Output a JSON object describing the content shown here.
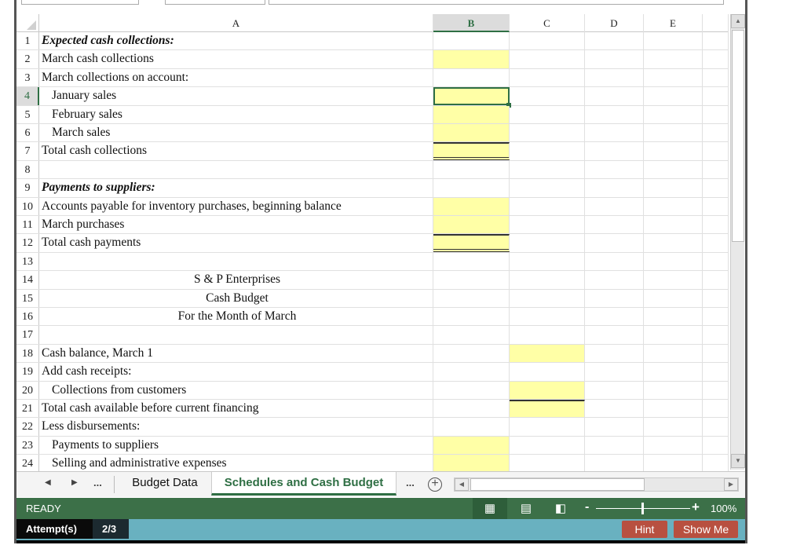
{
  "columns": [
    "A",
    "B",
    "C",
    "D",
    "E"
  ],
  "selected_column": "B",
  "selected_row": 4,
  "rows": [
    {
      "n": "1",
      "a": "Expected cash collections:",
      "style": "bi"
    },
    {
      "n": "2",
      "a": "March cash collections",
      "style": ""
    },
    {
      "n": "3",
      "a": "March collections on account:",
      "style": ""
    },
    {
      "n": "4",
      "a": "January sales",
      "style": "indent"
    },
    {
      "n": "5",
      "a": "February sales",
      "style": "indent"
    },
    {
      "n": "6",
      "a": "March sales",
      "style": "indent"
    },
    {
      "n": "7",
      "a": "Total cash collections",
      "style": ""
    },
    {
      "n": "8",
      "a": "",
      "style": ""
    },
    {
      "n": "9",
      "a": "Payments to suppliers:",
      "style": "bi"
    },
    {
      "n": "10",
      "a": "Accounts payable for inventory purchases, beginning balance",
      "style": ""
    },
    {
      "n": "11",
      "a": "March purchases",
      "style": ""
    },
    {
      "n": "12",
      "a": "Total cash payments",
      "style": ""
    },
    {
      "n": "13",
      "a": "",
      "style": ""
    },
    {
      "n": "14",
      "a": "S & P Enterprises",
      "style": "center"
    },
    {
      "n": "15",
      "a": "Cash Budget",
      "style": "center"
    },
    {
      "n": "16",
      "a": "For the Month of March",
      "style": "center"
    },
    {
      "n": "17",
      "a": "",
      "style": ""
    },
    {
      "n": "18",
      "a": "Cash balance, March 1",
      "style": ""
    },
    {
      "n": "19",
      "a": "Add cash receipts:",
      "style": ""
    },
    {
      "n": "20",
      "a": "Collections from customers",
      "style": "indent"
    },
    {
      "n": "21",
      "a": "Total cash available before current financing",
      "style": ""
    },
    {
      "n": "22",
      "a": "Less disbursements:",
      "style": ""
    },
    {
      "n": "23",
      "a": "Payments to suppliers",
      "style": "indent"
    },
    {
      "n": "24",
      "a": "Selling and administrative expenses",
      "style": "indent"
    }
  ],
  "sheet_tabs": {
    "nav_prev": "◀",
    "nav_next": "▶",
    "ellipsis": "...",
    "tabs": [
      {
        "label": "Budget Data",
        "active": false
      },
      {
        "label": "Schedules and Cash Budget",
        "active": true
      }
    ],
    "more": "...",
    "add_sheet": "+"
  },
  "status": {
    "mode": "READY",
    "zoom_level": "100%",
    "zoom_minus": "-",
    "zoom_plus": "+",
    "zoom_fraction": 0.5
  },
  "attempts": {
    "label": "Attempt(s)",
    "count": "2/3",
    "hint_label": "Hint",
    "show_me_label": "Show Me"
  },
  "colors": {
    "input_fill": "#ffffa6",
    "excel_green": "#3c7048",
    "attempt_bar": "#69b1c0",
    "action_button": "#b85040"
  }
}
